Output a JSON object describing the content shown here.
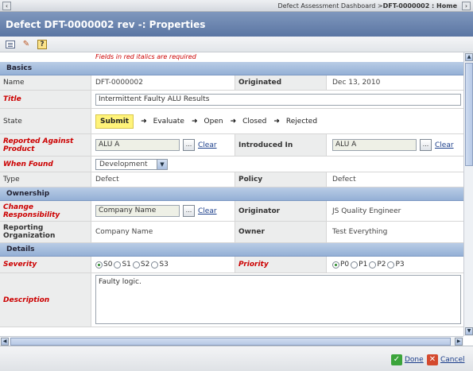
{
  "breadcrumb": {
    "parent": "Defect Assessment Dashboard",
    "separator": ">",
    "current": "DFT-0000002 : Home"
  },
  "header": {
    "title": "Defect DFT-0000002 rev -: Properties"
  },
  "toolbar": {
    "icons": [
      "edit-details-icon",
      "edit-attributes-icon",
      "help-icon"
    ]
  },
  "required_note": "Fields in red italics are required",
  "sections": {
    "basics": "Basics",
    "ownership": "Ownership",
    "details": "Details"
  },
  "basics": {
    "name": {
      "label": "Name",
      "value": "DFT-0000002"
    },
    "originated": {
      "label": "Originated",
      "value": "Dec 13, 2010"
    },
    "title": {
      "label": "Title",
      "value": "Intermittent Faulty ALU Results"
    },
    "state": {
      "label": "State",
      "current": "Submit",
      "next": [
        "Evaluate",
        "Open",
        "Closed",
        "Rejected"
      ],
      "arrow": "➜"
    },
    "reported_against": {
      "label": "Reported Against Product",
      "value": "ALU A",
      "browse": "...",
      "clear": "Clear"
    },
    "introduced_in": {
      "label": "Introduced In",
      "value": "ALU A",
      "browse": "...",
      "clear": "Clear"
    },
    "when_found": {
      "label": "When Found",
      "value": "Development"
    },
    "type": {
      "label": "Type",
      "value": "Defect"
    },
    "policy": {
      "label": "Policy",
      "value": "Defect"
    }
  },
  "ownership": {
    "change_responsibility": {
      "label": "Change Responsibility",
      "value": "Company Name",
      "browse": "...",
      "clear": "Clear"
    },
    "originator": {
      "label": "Originator",
      "value": "JS Quality Engineer"
    },
    "reporting_org": {
      "label": "Reporting Organization",
      "value": "Company Name"
    },
    "owner": {
      "label": "Owner",
      "value": "Test Everything"
    }
  },
  "details": {
    "severity": {
      "label": "Severity",
      "options": [
        "S0",
        "S1",
        "S2",
        "S3"
      ],
      "selected": "S0"
    },
    "priority": {
      "label": "Priority",
      "options": [
        "P0",
        "P1",
        "P2",
        "P3"
      ],
      "selected": "P0"
    },
    "description": {
      "label": "Description",
      "value": "Faulty logic."
    }
  },
  "footer": {
    "done": "Done",
    "cancel": "Cancel"
  },
  "colors": {
    "header": "#6a84b0",
    "required": "#cc0000",
    "section": "#a9c0e0",
    "current_state": "#fff37a"
  }
}
